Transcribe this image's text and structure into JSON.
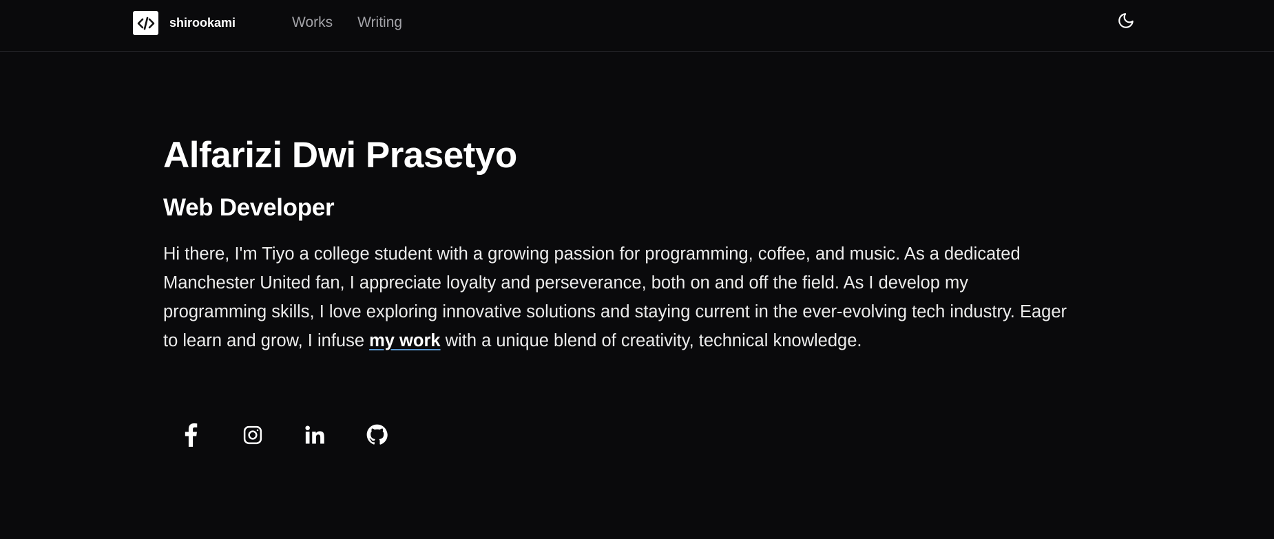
{
  "header": {
    "brand": {
      "name": "shirookami",
      "icon": "code-icon"
    },
    "nav": [
      {
        "label": "Works"
      },
      {
        "label": "Writing"
      }
    ],
    "theme_toggle": {
      "icon": "moon-icon"
    }
  },
  "hero": {
    "name": "Alfarizi Dwi Prasetyo",
    "role": "Web Developer",
    "bio_before": "Hi there, I'm Tiyo a college student with a growing passion for programming, coffee, and music. As a dedicated Manchester United fan, I appreciate loyalty and perseverance, both on and off the field. As I develop my programming skills, I love exploring innovative solutions and staying current in the ever-evolving tech industry. Eager to learn and grow, I infuse ",
    "bio_link": "my work",
    "bio_after": " with a unique blend of creativity, technical knowledge."
  },
  "socials": [
    {
      "icon": "facebook-icon"
    },
    {
      "icon": "instagram-icon"
    },
    {
      "icon": "linkedin-icon"
    },
    {
      "icon": "github-icon"
    }
  ],
  "colors": {
    "background": "#0a0a0c",
    "text": "#ffffff",
    "muted": "#a3a3a8",
    "link_underline": "#5b9bd5"
  }
}
